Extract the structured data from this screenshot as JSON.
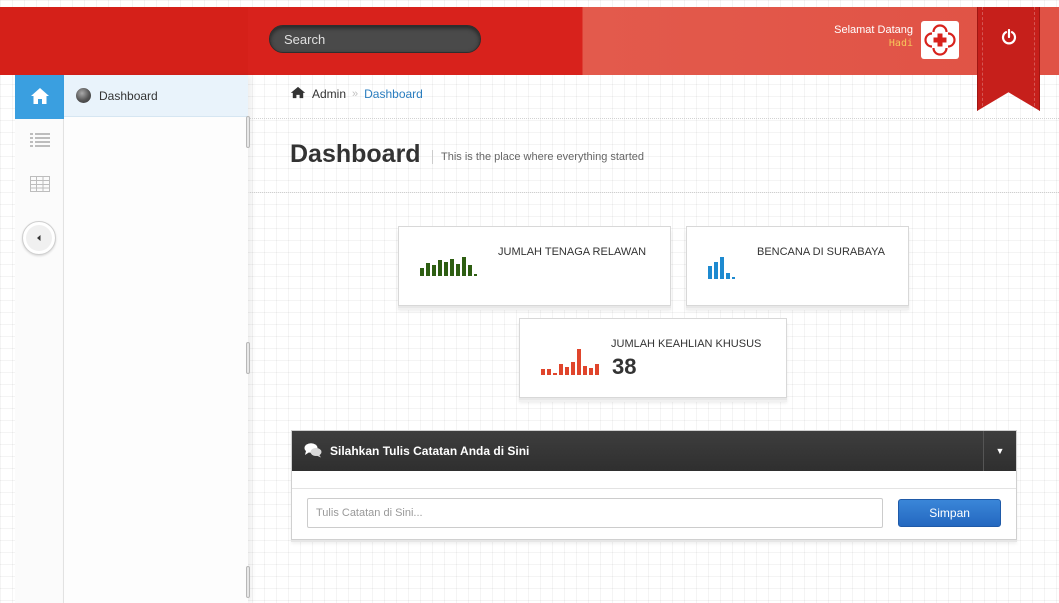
{
  "header": {
    "search_placeholder": "Search",
    "welcome_text": "Selamat Datang",
    "username": "Hadi",
    "logo_icon": "red-cross-flower-icon",
    "power_icon": "power-icon",
    "colors": {
      "primary": "#d8221c",
      "secondary": "#e05245",
      "ribbon": "#c61f1b"
    }
  },
  "rail": {
    "items": [
      {
        "icon": "home-icon",
        "active": true
      },
      {
        "icon": "list-icon",
        "active": false
      },
      {
        "icon": "table-icon",
        "active": false
      }
    ],
    "toggle_icon": "chevron-left-icon",
    "accent": "#3a9fe0"
  },
  "sidebar": {
    "items": [
      {
        "label": "Dashboard",
        "icon": "dashboard-icon"
      }
    ]
  },
  "breadcrumb": {
    "root": "Admin",
    "separator": "»",
    "current": "Dashboard"
  },
  "page": {
    "title": "Dashboard",
    "subtitle": "This is the place where everything started"
  },
  "stats": [
    {
      "label": "JUMLAH TENAGA RELAWAN",
      "value": "",
      "color": "#2e5e12",
      "icon": "bar-chart-icon"
    },
    {
      "label": "BENCANA DI SURABAYA",
      "value": "",
      "color": "#1e8ad0",
      "icon": "bar-chart-icon"
    },
    {
      "label": "JUMLAH KEAHLIAN KHUSUS",
      "value": "38",
      "color": "#e0452c",
      "icon": "bar-chart-icon"
    }
  ],
  "notes": {
    "title": "Silahkan Tulis Catatan Anda di Sini",
    "icon": "chat-bubbles-icon",
    "toggle_icon": "caret-down-icon",
    "input_placeholder": "Tulis Catatan di Sini...",
    "input_value": "",
    "save_label": "Simpan"
  }
}
